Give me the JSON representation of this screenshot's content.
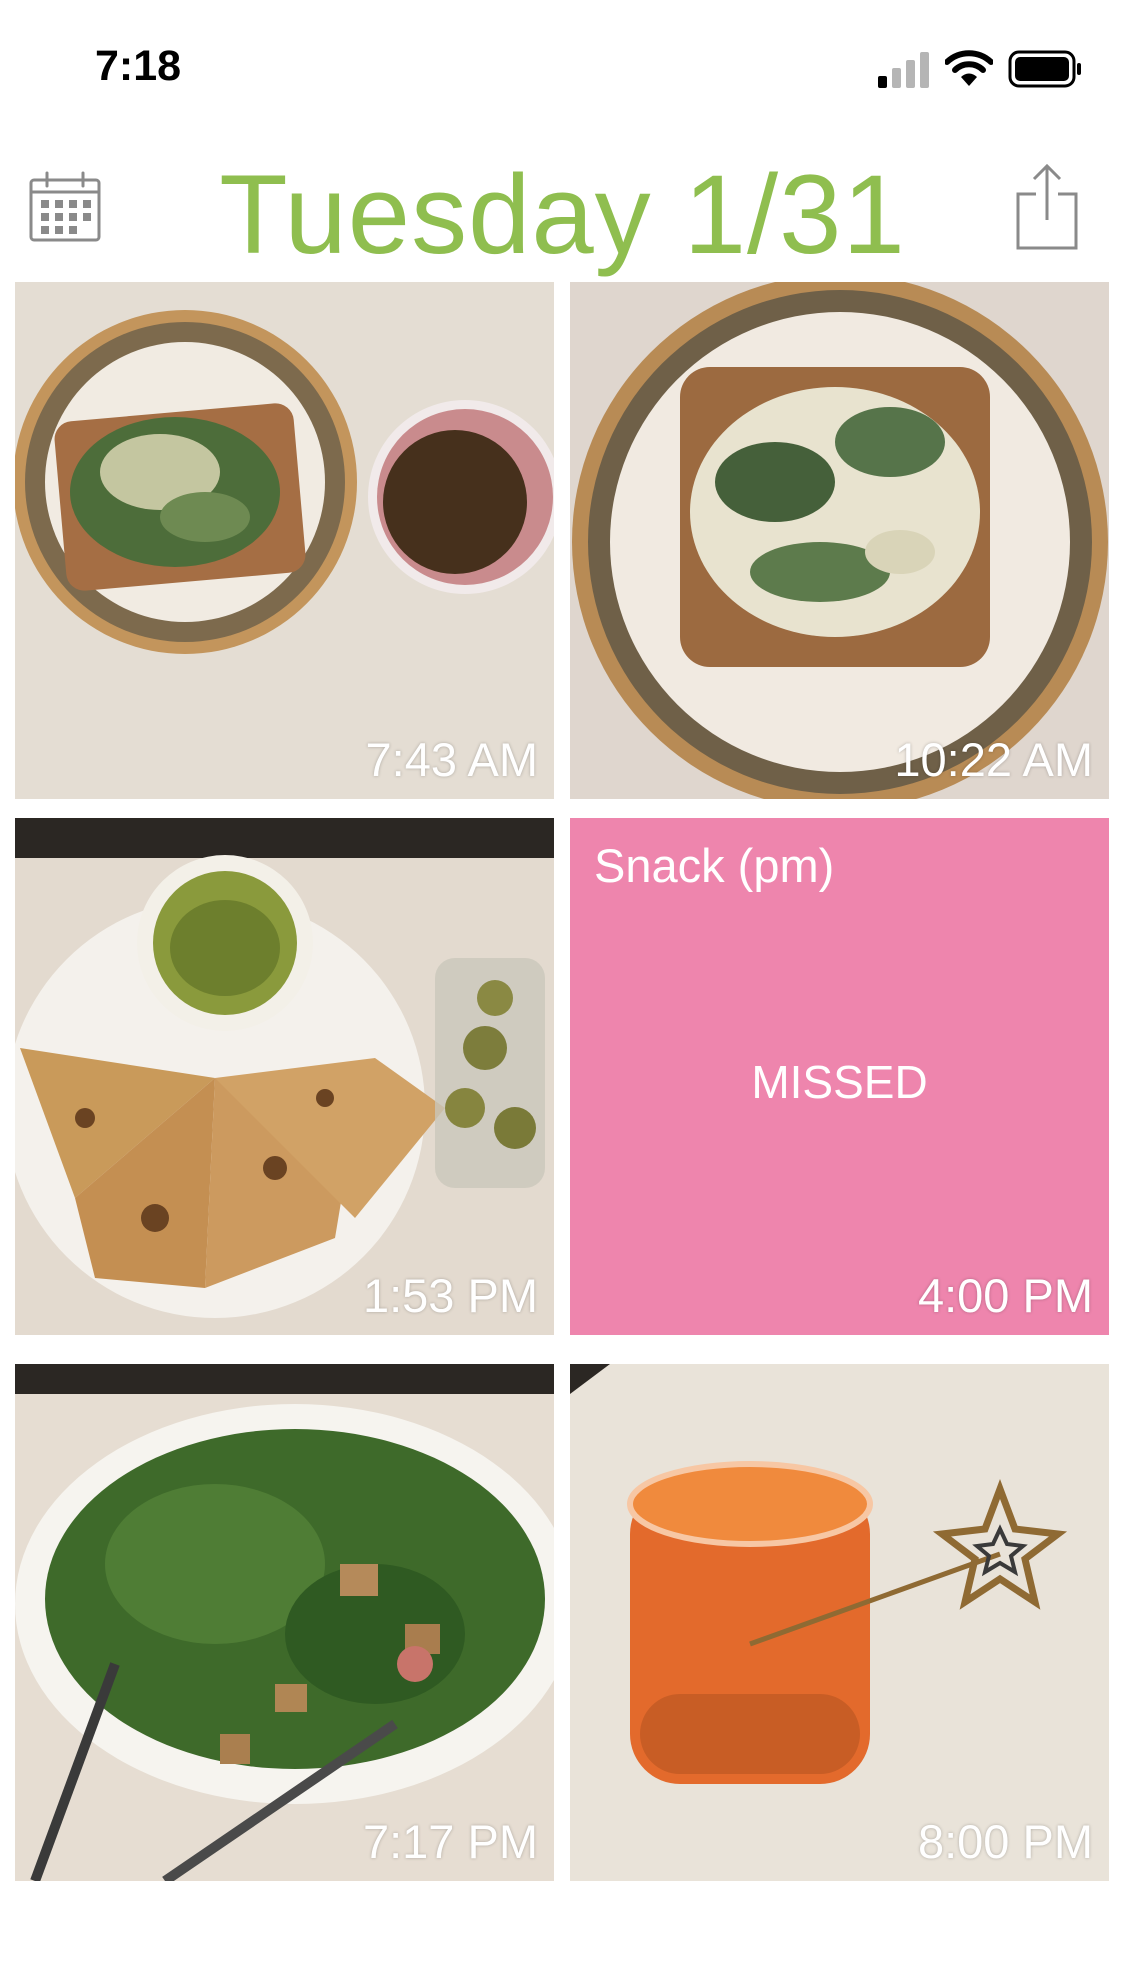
{
  "status_bar": {
    "time": "7:18"
  },
  "header": {
    "title": "Tuesday 1/31",
    "calendar_icon": "calendar-icon",
    "share_icon": "share-icon"
  },
  "colors": {
    "title_green": "#8fbe4f",
    "missed_pink": "#ee85ad",
    "icon_gray": "#8a8a8a"
  },
  "meals": [
    {
      "time": "7:43 AM",
      "photo": "toast with greens and a cup of tea"
    },
    {
      "time": "10:22 AM",
      "photo": "toast with egg salad and greens"
    },
    {
      "time": "1:53 PM",
      "photo": "quesadilla with guacamole and grapes"
    },
    {
      "label": "Snack (pm)",
      "status": "MISSED",
      "time": "4:00 PM"
    },
    {
      "time": "7:17 PM",
      "photo": "spinach salad with croutons"
    },
    {
      "time": "8:00 PM",
      "photo": "jar of orange drink with star stirrer"
    }
  ]
}
